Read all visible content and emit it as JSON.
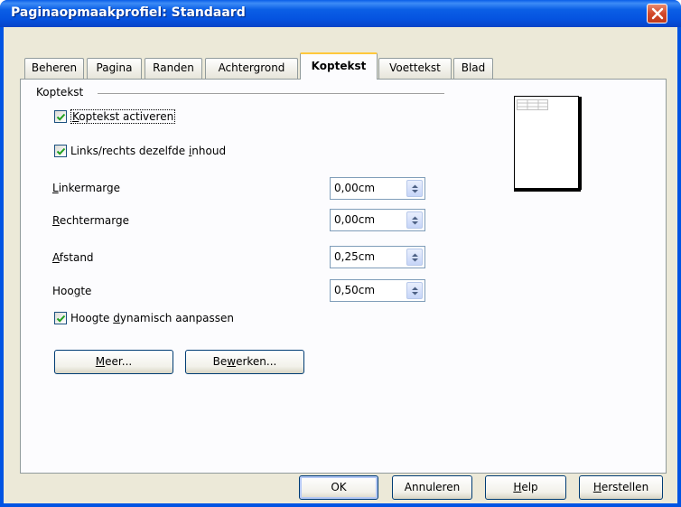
{
  "window": {
    "title": "Paginaopmaakprofiel: Standaard"
  },
  "tabs": [
    {
      "label": "Beheren"
    },
    {
      "label": "Pagina"
    },
    {
      "label": "Randen"
    },
    {
      "label": "Achtergrond"
    },
    {
      "label": "Koptekst",
      "active": true
    },
    {
      "label": "Voettekst"
    },
    {
      "label": "Blad"
    }
  ],
  "header_group": {
    "label": "Koptekst",
    "activate": {
      "pre": "",
      "mnemonic": "K",
      "post": "optekst activeren",
      "checked": true
    },
    "same_content": {
      "pre": "Links/rechts dezelfde ",
      "mnemonic": "i",
      "post": "nhoud",
      "checked": true
    },
    "left_margin": {
      "pre": "",
      "mnemonic": "L",
      "post": "inkermarge",
      "value": "0,00cm"
    },
    "right_margin": {
      "pre": "",
      "mnemonic": "R",
      "post": "echtermarge",
      "value": "0,00cm"
    },
    "spacing": {
      "pre": "",
      "mnemonic": "A",
      "post": "fstand",
      "value": "0,25cm"
    },
    "height": {
      "pre": "Hoo",
      "mnemonic": "g",
      "post": "te",
      "value": "0,50cm"
    },
    "autofit": {
      "pre": "Hoogte ",
      "mnemonic": "d",
      "post": "ynamisch aanpassen",
      "checked": true
    },
    "more_button": {
      "pre": "",
      "mnemonic": "M",
      "post": "eer..."
    },
    "edit_button": {
      "pre": "Be",
      "mnemonic": "w",
      "post": "erken..."
    }
  },
  "footer_buttons": {
    "ok": "OK",
    "cancel": "Annuleren",
    "help": {
      "pre": "",
      "mnemonic": "H",
      "post": "elp"
    },
    "reset": {
      "pre": "",
      "mnemonic": "H",
      "post": "erstellen"
    }
  },
  "colors": {
    "titlebar": "#0054e3",
    "dialog_bg": "#ece9d8",
    "active_tab_accent": "#ffc83c"
  },
  "icons": {
    "close": "close-icon",
    "check": "checkmark-icon",
    "spin": "spin-updown-icon"
  }
}
